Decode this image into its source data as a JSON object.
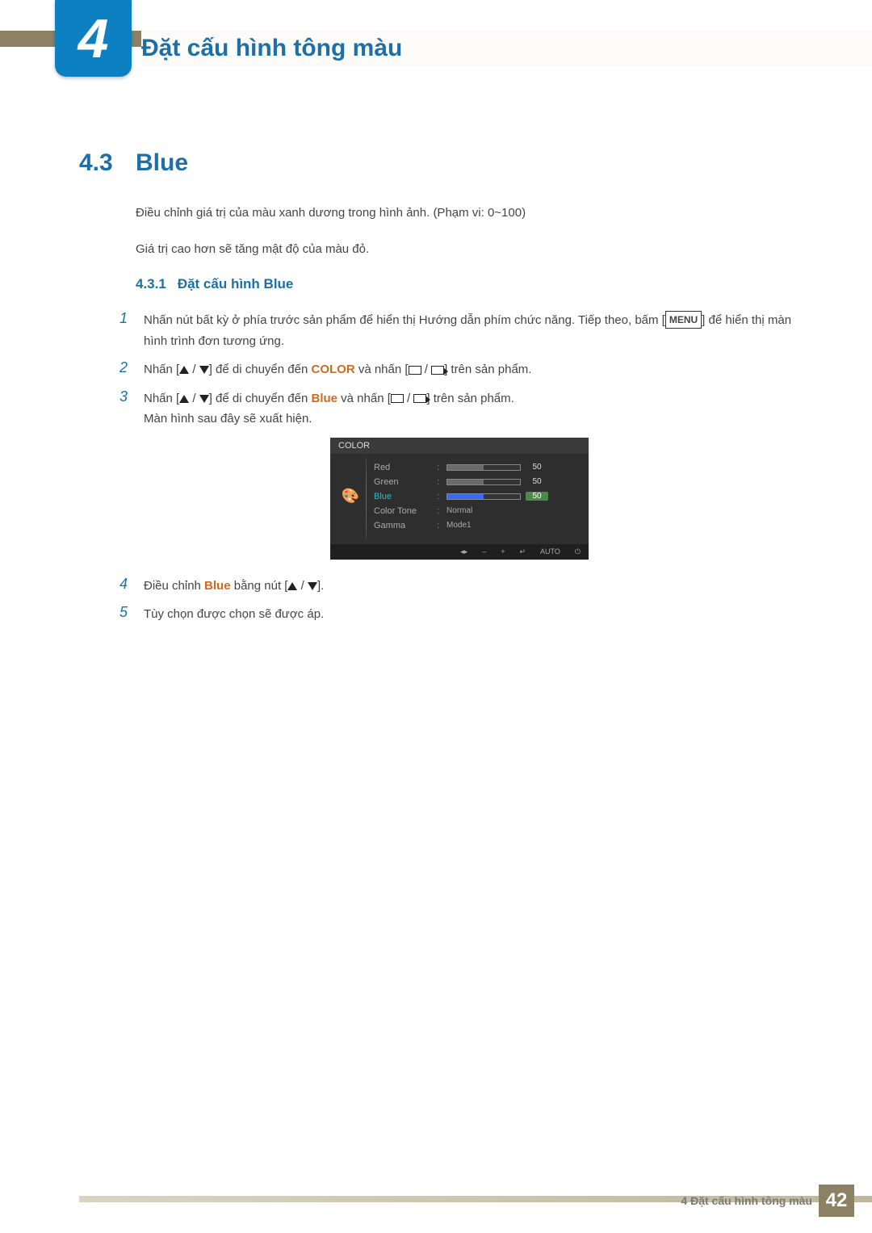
{
  "chapter": {
    "number": "4",
    "title": "Đặt cấu hình tông màu"
  },
  "section": {
    "number": "4.3",
    "title": "Blue"
  },
  "paragraphs": {
    "p1": "Điều chỉnh giá trị của màu xanh dương trong hình ảnh. (Phạm vi: 0~100)",
    "p2": "Giá trị cao hơn sẽ tăng mật độ của màu đỏ."
  },
  "subsection": {
    "number": "4.3.1",
    "title": "Đặt cấu hình Blue"
  },
  "steps": {
    "s1": {
      "n": "1",
      "a": "Nhấn nút bất kỳ ở phía trước sản phẩm để hiển thị Hướng dẫn phím chức năng. Tiếp theo, bấm [",
      "menu": "MENU",
      "b": "] để hiển thị màn hình trình đơn tương ứng."
    },
    "s2": {
      "n": "2",
      "a": "Nhấn [",
      "b": "] để di chuyển đến ",
      "kw": "COLOR",
      "c": " và nhấn [",
      "d": "] trên sản phẩm."
    },
    "s3": {
      "n": "3",
      "a": "Nhấn [",
      "b": "] để di chuyển đến ",
      "kw": "Blue",
      "c": " và nhấn [",
      "d": "] trên sản phẩm.",
      "e": "Màn hình sau đây sẽ xuất hiện."
    },
    "s4": {
      "n": "4",
      "a": "Điều chỉnh ",
      "kw": "Blue",
      "b": " bằng nút [",
      "c": "]."
    },
    "s5": {
      "n": "5",
      "a": "Tùy chọn được chọn sẽ được áp."
    }
  },
  "osd": {
    "title": "COLOR",
    "rows": {
      "red": {
        "label": "Red",
        "val": "50"
      },
      "green": {
        "label": "Green",
        "val": "50"
      },
      "blue": {
        "label": "Blue",
        "val": "50"
      },
      "tone": {
        "label": "Color Tone",
        "val": "Normal"
      },
      "gamma": {
        "label": "Gamma",
        "val": "Mode1"
      }
    },
    "footer": {
      "auto": "AUTO"
    }
  },
  "footer": {
    "text": "4 Đặt cấu hình tông màu",
    "page": "42"
  },
  "chart_data": {
    "type": "table",
    "title": "COLOR OSD menu",
    "rows": [
      {
        "label": "Red",
        "value": 50,
        "range": [
          0,
          100
        ]
      },
      {
        "label": "Green",
        "value": 50,
        "range": [
          0,
          100
        ]
      },
      {
        "label": "Blue",
        "value": 50,
        "range": [
          0,
          100
        ],
        "selected": true
      },
      {
        "label": "Color Tone",
        "value": "Normal"
      },
      {
        "label": "Gamma",
        "value": "Mode1"
      }
    ]
  }
}
